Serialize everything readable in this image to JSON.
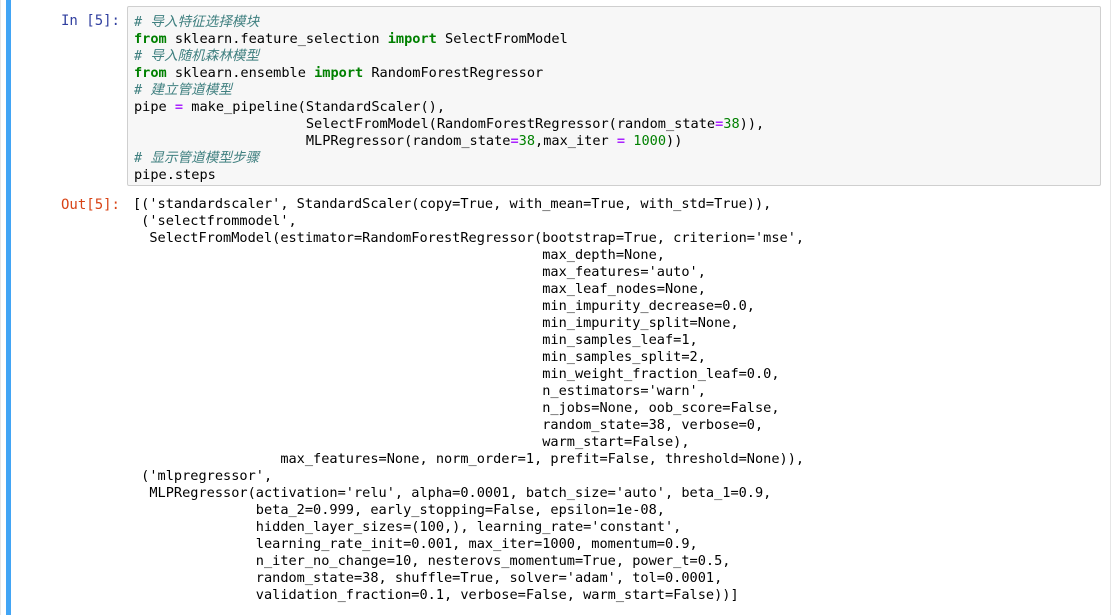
{
  "cell": {
    "in_prompt": "In [5]:",
    "out_prompt": "Out[5]:"
  },
  "input": {
    "comment_import_fs": "# 导入特征选择模块",
    "line_from1_kw": "from",
    "line_from1_mod": " sklearn.feature_selection ",
    "line_from1_import": "import",
    "line_from1_name": " SelectFromModel",
    "comment_import_rf": "# 导入随机森林模型",
    "line_from2_kw": "from",
    "line_from2_mod": " sklearn.ensemble ",
    "line_from2_import": "import",
    "line_from2_name": " RandomForestRegressor",
    "comment_pipe": "# 建立管道模型",
    "pipe_lhs": "pipe ",
    "pipe_eq": "=",
    "pipe_rhs": " make_pipeline(StandardScaler(),",
    "pipe_line2_pre": "                     SelectFromModel(RandomForestRegressor(random_state",
    "pipe_line2_eq": "=",
    "pipe_line2_num": "38",
    "pipe_line2_post": ")),",
    "pipe_line3_pre": "                     MLPRegressor(random_state",
    "pipe_line3_eq1": "=",
    "pipe_line3_num1": "38",
    "pipe_line3_mid": ",max_iter ",
    "pipe_line3_eq2": "=",
    "pipe_line3_sp": " ",
    "pipe_line3_num2": "1000",
    "pipe_line3_post": "))",
    "comment_show": "# 显示管道模型步骤",
    "last_line": "pipe.steps"
  },
  "output": {
    "text": "[('standardscaler', StandardScaler(copy=True, with_mean=True, with_std=True)),\n ('selectfrommodel',\n  SelectFromModel(estimator=RandomForestRegressor(bootstrap=True, criterion='mse',\n                                                  max_depth=None,\n                                                  max_features='auto',\n                                                  max_leaf_nodes=None,\n                                                  min_impurity_decrease=0.0,\n                                                  min_impurity_split=None,\n                                                  min_samples_leaf=1,\n                                                  min_samples_split=2,\n                                                  min_weight_fraction_leaf=0.0,\n                                                  n_estimators='warn',\n                                                  n_jobs=None, oob_score=False,\n                                                  random_state=38, verbose=0,\n                                                  warm_start=False),\n                  max_features=None, norm_order=1, prefit=False, threshold=None)),\n ('mlpregressor',\n  MLPRegressor(activation='relu', alpha=0.0001, batch_size='auto', beta_1=0.9,\n               beta_2=0.999, early_stopping=False, epsilon=1e-08,\n               hidden_layer_sizes=(100,), learning_rate='constant',\n               learning_rate_init=0.001, max_iter=1000, momentum=0.9,\n               n_iter_no_change=10, nesterovs_momentum=True, power_t=0.5,\n               random_state=38, shuffle=True, solver='adam', tol=0.0001,\n               validation_fraction=0.1, verbose=False, warm_start=False))]"
  },
  "colors": {
    "selected_bar": "#42a5f5",
    "in_prompt": "#303f9f",
    "out_prompt": "#d84315",
    "comment": "#408080",
    "keyword": "#008000",
    "operator": "#aa22ff",
    "input_bg": "#f7f7f7"
  }
}
